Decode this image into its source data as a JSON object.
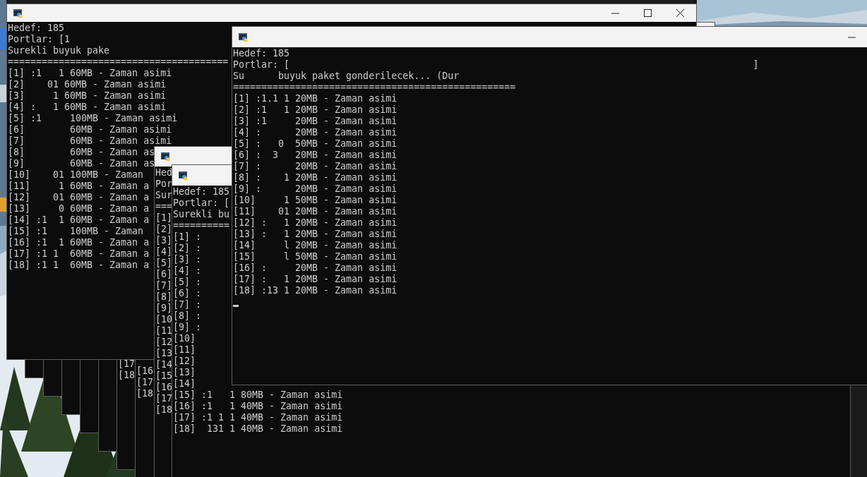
{
  "windows": [
    {
      "kind": "console"
    },
    {
      "kind": "console"
    },
    {
      "kind": "console"
    },
    {
      "kind": "console"
    },
    {
      "kind": "console"
    },
    {
      "kind": "console",
      "lines": [
        "[17",
        "[18"
      ]
    },
    {
      "kind": "console",
      "lines": [
        "[16",
        "[17",
        "[18"
      ]
    },
    {
      "kind": "console",
      "lines": [
        "Hedef: 185",
        "Portlar: [1",
        "Surekli buyuk pake",
        "=======================================",
        "[1] :1   1 60MB - Zaman asimi",
        "[2]    01 60MB - Zaman asimi",
        "[3]     1 60MB - Zaman asimi",
        "[4] :   1 60MB - Zaman asimi",
        "[5] :1     100MB - Zaman asimi",
        "[6]        60MB - Zaman asimi",
        "[7]        60MB - Zaman asimi",
        "[8]        60MB - Zaman as",
        "[9]        60MB - Zaman as",
        "[10]    01 100MB - Zaman",
        "[11]     1 60MB - Zaman a",
        "[12]    01 60MB - Zaman a",
        "[13]     0 60MB - Zaman a",
        "[14] :1  1 60MB - Zaman a",
        "[15] :1    100MB - Zaman",
        "[16] :1  1 60MB - Zaman a",
        "[17] :1 1  60MB - Zaman a",
        "[18] :1 1  60MB - Zaman a"
      ]
    },
    {
      "kind": "console",
      "lines": [
        "Hed",
        "Por",
        "Sur",
        "===",
        "[1]",
        "[2]",
        "[3]",
        "[4]",
        "[5]",
        "[6]",
        "[7]",
        "[8]",
        "[9]",
        "[10",
        "[11",
        "[12",
        "[13",
        "[14",
        "[15",
        "[16",
        "[17",
        "[18"
      ]
    },
    {
      "kind": "console",
      "lines": [
        "Hedef: 185",
        "Portlar: [",
        "Surekli bu",
        "==========",
        "[1] :",
        "[2] :",
        "[3] :",
        "[4] :",
        "[5] :",
        "[6] :",
        "[7] :",
        "[8] :",
        "[9] :",
        "[10]",
        "[11]",
        "[12]",
        "[13]",
        "[14]",
        "[15] :1   1 80MB - Zaman asimi",
        "[16] :1   1 40MB - Zaman asimi",
        "[17] :1 1 1 40MB - Zaman asimi",
        "[18]  131 1 40MB - Zaman asimi"
      ]
    },
    {
      "kind": "console",
      "cursor": true,
      "lines": [
        "Hedef: 185",
        "Portlar: [                                                                                  ]",
        "Su      buyuk paket gonderilecek... (Dur",
        "==================================================",
        "[1] :1.1 1 20MB - Zaman asimi",
        "[2] :1   1 20MB - Zaman asimi",
        "[3] :1     20MB - Zaman asimi",
        "[4] :      20MB - Zaman asimi",
        "[5] :   0  50MB - Zaman asimi",
        "[6] :  3   20MB - Zaman asimi",
        "[7] :      20MB - Zaman asimi",
        "[8] :    1 20MB - Zaman asimi",
        "[9] :      20MB - Zaman asimi",
        "[10]     1 50MB - Zaman asimi",
        "[11]    01 20MB - Zaman asimi",
        "[12] :   1 20MB - Zaman asimi",
        "[13] :   1 20MB - Zaman asimi",
        "[14]     l 20MB - Zaman asimi",
        "[15]     l 50MB - Zaman asimi",
        "[16] :     20MB - Zaman asimi",
        "[17] :   1 20MB - Zaman asimi",
        "[18] :13 1 20MB - Zaman asimi"
      ]
    }
  ]
}
